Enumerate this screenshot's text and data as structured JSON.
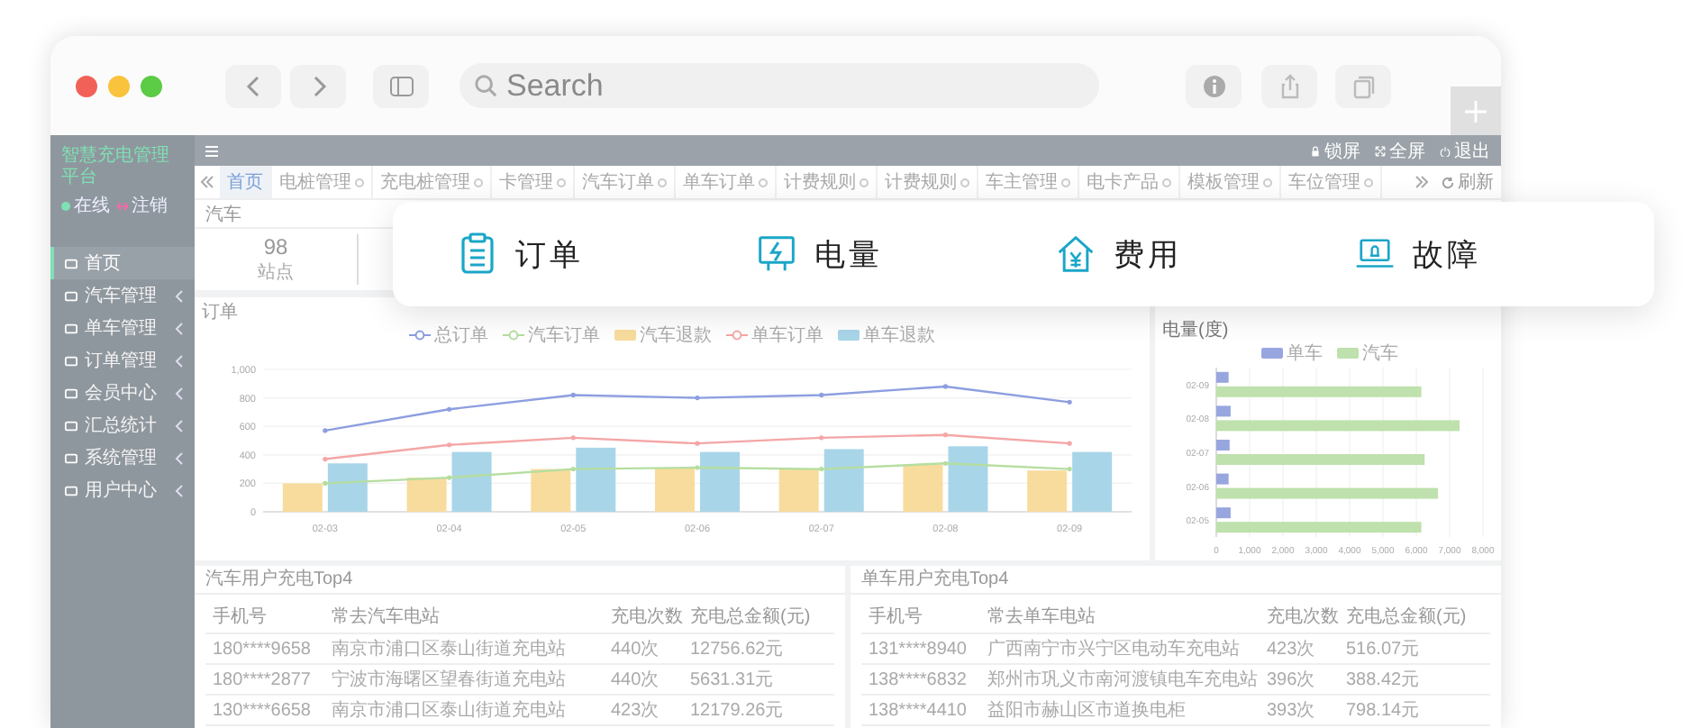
{
  "browser": {
    "search": {
      "placeholder": "Search"
    }
  },
  "sidebar": {
    "title": "智慧充电管理平台",
    "status": [
      {
        "kind": "online",
        "label": "在线"
      },
      {
        "kind": "logout",
        "label": "注销"
      }
    ],
    "items": [
      {
        "label": "首页",
        "selected": true
      },
      {
        "label": "汽车管理",
        "selected": false
      },
      {
        "label": "单车管理",
        "selected": false
      },
      {
        "label": "订单管理",
        "selected": false
      },
      {
        "label": "会员中心",
        "selected": false
      },
      {
        "label": "汇总统计",
        "selected": false
      },
      {
        "label": "系统管理",
        "selected": false
      },
      {
        "label": "用户中心",
        "selected": false
      }
    ]
  },
  "header": {
    "actions": [
      {
        "kind": "lock",
        "label": "锁屏"
      },
      {
        "kind": "fullscreen",
        "label": "全屏"
      },
      {
        "kind": "logout",
        "label": "退出"
      }
    ]
  },
  "tabs": [
    {
      "label": "首页",
      "selected": true,
      "closable": false
    },
    {
      "label": "电桩管理",
      "selected": false,
      "closable": true
    },
    {
      "label": "充电桩管理",
      "selected": false,
      "closable": true
    },
    {
      "label": "卡管理",
      "selected": false,
      "closable": true
    },
    {
      "label": "汽车订单",
      "selected": false,
      "closable": true
    },
    {
      "label": "单车订单",
      "selected": false,
      "closable": true
    },
    {
      "label": "计费规则",
      "selected": false,
      "closable": true
    },
    {
      "label": "计费规则",
      "selected": false,
      "closable": true
    },
    {
      "label": "车主管理",
      "selected": false,
      "closable": true
    },
    {
      "label": "电卡产品",
      "selected": false,
      "closable": true
    },
    {
      "label": "模板管理",
      "selected": false,
      "closable": true
    },
    {
      "label": "车位管理",
      "selected": false,
      "closable": true
    }
  ],
  "refresh": "刷新",
  "section_title": "汽车",
  "stats": [
    {
      "value": "98",
      "label": "站点"
    }
  ],
  "summary_card": [
    {
      "kind": "order",
      "label": "订单"
    },
    {
      "kind": "power",
      "label": "电量"
    },
    {
      "kind": "fee",
      "label": "费用"
    },
    {
      "kind": "fault",
      "label": "故障"
    }
  ],
  "order_panel": {
    "title": "订单",
    "chart_data": {
      "type": "bar",
      "categories": [
        "02-03",
        "02-04",
        "02-05",
        "02-06",
        "02-07",
        "02-08",
        "02-09"
      ],
      "ylim": [
        0,
        1000
      ],
      "yticks": [
        0,
        {
          "value": 200,
          "label": "200"
        },
        400,
        600,
        800,
        {
          "value": 1000,
          "label": "1,000"
        }
      ],
      "stacked": false,
      "grid": true,
      "series": [
        {
          "name": "总订单",
          "type": "line",
          "color": "#8d9ee0",
          "values": [
            570,
            720,
            820,
            800,
            820,
            880,
            770
          ]
        },
        {
          "name": "汽车订单",
          "type": "line",
          "color": "#b5dea0",
          "values": [
            200,
            240,
            300,
            310,
            300,
            340,
            300
          ]
        },
        {
          "name": "汽车退款",
          "type": "bar",
          "color": "#f8dc9d",
          "values": [
            200,
            240,
            300,
            310,
            300,
            330,
            290
          ]
        },
        {
          "name": "单车订单",
          "type": "line",
          "color": "#f4a6a6",
          "values": [
            370,
            470,
            520,
            480,
            520,
            540,
            480
          ]
        },
        {
          "name": "单车退款",
          "type": "bar",
          "color": "#a9d5e8",
          "values": [
            340,
            420,
            450,
            420,
            440,
            460,
            420
          ]
        }
      ]
    }
  },
  "power_panel": {
    "title": "电量(度)",
    "chart_data": {
      "type": "bar",
      "orientation": "horizontal",
      "categories": [
        "02-09",
        "02-08",
        "02-07",
        "02-06",
        "02-05"
      ],
      "xlim": [
        0,
        8000
      ],
      "grid": true,
      "xticks": [
        0,
        {
          "value": 1000,
          "label": "1,000"
        },
        {
          "value": 2000,
          "label": "2,000"
        },
        {
          "value": 3000,
          "label": "3,000"
        },
        {
          "value": 4000,
          "label": "4,000"
        },
        {
          "value": 5000,
          "label": "5,000"
        },
        {
          "value": 6000,
          "label": "6,000"
        },
        {
          "value": 7000,
          "label": "7,000"
        },
        {
          "value": 8000,
          "label": "8,000"
        }
      ],
      "series": [
        {
          "name": "单车",
          "color": "#98a6e0",
          "values": [
            370,
            430,
            400,
            370,
            430
          ]
        },
        {
          "name": "汽车",
          "color": "#bfe1ad",
          "values": [
            6150,
            7300,
            6250,
            6650,
            6150
          ]
        }
      ]
    }
  },
  "tables": [
    {
      "title": "汽车用户充电Top4",
      "columns": [
        "手机号",
        "常去汽车电站",
        "充电次数",
        "充电总金额(元)"
      ],
      "rows": [
        [
          "180****9658",
          "南京市浦口区泰山街道充电站",
          "440次",
          "12756.62元"
        ],
        [
          "180****2877",
          "宁波市海曙区望春街道充电站",
          "440次",
          "5631.31元"
        ],
        [
          "130****6658",
          "南京市浦口区泰山街道充电站",
          "423次",
          "12179.26元"
        ]
      ]
    },
    {
      "title": "单车用户充电Top4",
      "columns": [
        "手机号",
        "常去单车电站",
        "充电次数",
        "充电总金额(元)"
      ],
      "rows": [
        [
          "131****8940",
          "广西南宁市兴宁区电动车充电站",
          "423次",
          "516.07元"
        ],
        [
          "138****6832",
          "郑州市巩义市南河渡镇电车充电站",
          "396次",
          "388.42元"
        ],
        [
          "138****4410",
          "益阳市赫山区市道换电柜",
          "393次",
          "798.14元"
        ]
      ]
    }
  ]
}
